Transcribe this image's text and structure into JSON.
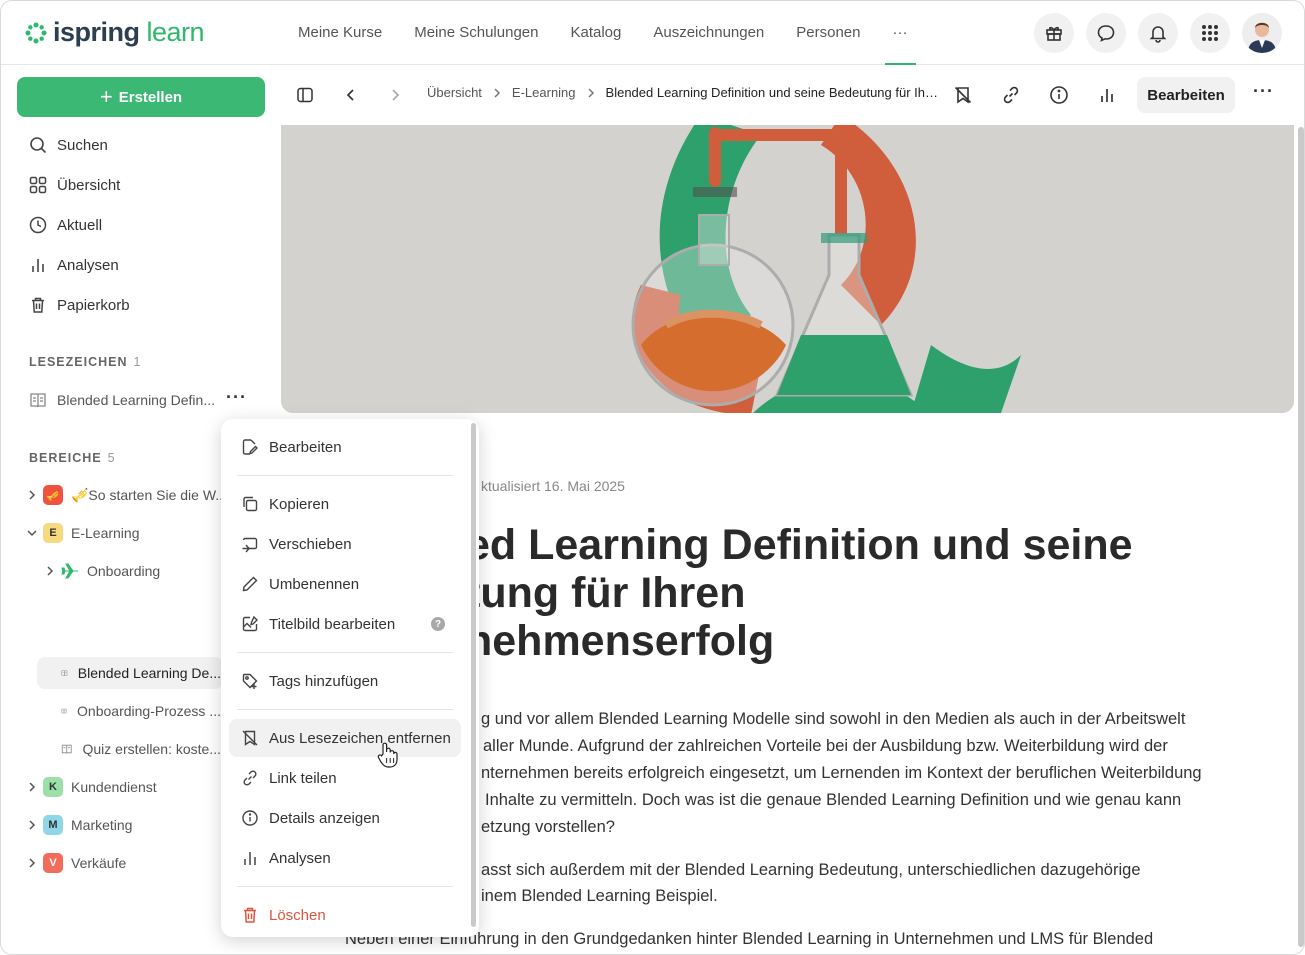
{
  "brand": {
    "logo_part1": "ispring",
    "logo_part2": "learn",
    "accent": "#3bb873"
  },
  "topnav": {
    "items": [
      "Meine Kurse",
      "Meine Schulungen",
      "Katalog",
      "Auszeichnungen",
      "Personen",
      "···"
    ],
    "icons": [
      "gift-icon",
      "chat-icon",
      "bell-icon",
      "apps-grid-icon",
      "avatar"
    ]
  },
  "sidebar": {
    "create_label": "Erstellen",
    "items": [
      {
        "label": "Suchen",
        "icon": "search-icon"
      },
      {
        "label": "Übersicht",
        "icon": "grid-icon"
      },
      {
        "label": "Aktuell",
        "icon": "clock-icon"
      },
      {
        "label": "Analysen",
        "icon": "bar-chart-icon"
      },
      {
        "label": "Papierkorb",
        "icon": "trash-icon"
      }
    ],
    "bookmarks_header": "LESEZEICHEN",
    "bookmarks_count": "1",
    "bookmark_item": "Blended Learning Defin...",
    "bookmark_more": "···",
    "areas_header": "BEREICHE",
    "areas_count": "5",
    "tree": [
      {
        "label": "🎺So starten Sie die W...",
        "badge": "🎺",
        "color": "#f0533d"
      },
      {
        "label": "E-Learning",
        "badge": "E",
        "color": "#f7d982"
      },
      {
        "label": "Onboarding",
        "badge": "✈"
      },
      {
        "label": "Blended Learning De...",
        "badge": "doc"
      },
      {
        "label": "Onboarding-Prozess ...",
        "badge": "doc"
      },
      {
        "label": "Quiz erstellen: koste...",
        "badge": "doc"
      },
      {
        "label": "Kundendienst",
        "badge": "K",
        "color": "#9be0a8"
      },
      {
        "label": "Marketing",
        "badge": "M",
        "color": "#8fd6e6"
      },
      {
        "label": "Verkäufe",
        "badge": "V",
        "color": "#f26b5b"
      }
    ]
  },
  "toolbar": {
    "crumbs": [
      "Übersicht",
      "E-Learning",
      "Blended Learning Definition und seine Bedeutung für Ihre..."
    ],
    "edit_label": "Bearbeiten",
    "more": "···"
  },
  "article": {
    "updated": "ktualisiert 16. Mai 2025",
    "title_lines": [
      "ed Learning Definition und seine",
      "tung für Ihren",
      "hehmenserfolg"
    ],
    "para1": [
      "g und vor allem Blended Learning Modelle sind sowohl in den Medien als auch in der Arbeitswelt",
      "aller Munde. Aufgrund der zahlreichen Vorteile bei der Ausbildung bzw. Weiterbildung wird der",
      "nternehmen bereits erfolgreich eingesetzt, um Lernenden im Kontext der beruflichen Weiterbildung",
      "Inhalte zu vermitteln. Doch was ist die genaue Blended Learning Definition und wie genau kann",
      "etzung vorstellen?"
    ],
    "para2": [
      "asst sich außerdem mit der Blended Learning Bedeutung, unterschiedlichen dazugehörige",
      "inem Blended Learning Beispiel."
    ],
    "para3": "Neben einer Einführung in den Grundgedanken hinter Blended Learning in Unternehmen und LMS für Blended"
  },
  "context_menu": {
    "items": [
      {
        "label": "Bearbeiten",
        "icon": "edit-icon"
      },
      {
        "label": "Kopieren",
        "icon": "copy-icon"
      },
      {
        "label": "Verschieben",
        "icon": "move-icon"
      },
      {
        "label": "Umbenennen",
        "icon": "pencil-icon"
      },
      {
        "label": "Titelbild bearbeiten",
        "icon": "image-edit-icon",
        "help": "?"
      },
      {
        "label": "Tags hinzufügen",
        "icon": "tag-icon"
      },
      {
        "label": "Aus Lesezeichen entfernen",
        "icon": "bookmark-remove-icon"
      },
      {
        "label": "Link teilen",
        "icon": "link-icon"
      },
      {
        "label": "Details anzeigen",
        "icon": "info-icon"
      },
      {
        "label": "Analysen",
        "icon": "bar-chart-icon"
      },
      {
        "label": "Löschen",
        "icon": "trash-icon"
      }
    ]
  }
}
